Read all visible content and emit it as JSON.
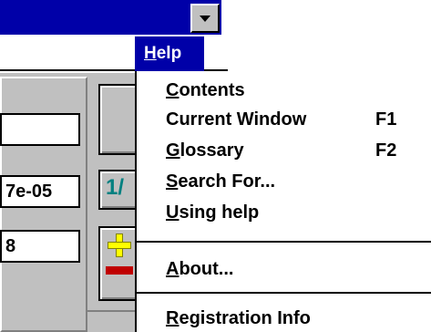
{
  "window": {
    "title": "",
    "dropdown_button_icon": "down-arrow-icon"
  },
  "menubar": {
    "help": {
      "first": "H",
      "rest": "elp"
    }
  },
  "panel": {
    "field2_value": "7e-05",
    "field3_value": "8",
    "fraction_button_text": "1/",
    "plus_icon": "plus-icon",
    "minus_icon": "minus-icon"
  },
  "help_menu": {
    "items": [
      {
        "first": "C",
        "rest": "ontents",
        "accel": ""
      },
      {
        "pre": "Current Window",
        "accel": "F1"
      },
      {
        "first": "G",
        "rest": "lossary",
        "accel": "F2"
      },
      {
        "first": "S",
        "rest": "earch For...",
        "accel": ""
      },
      {
        "first": "U",
        "rest": "sing help",
        "accel": ""
      },
      {
        "first": "A",
        "rest": "bout...",
        "accel": ""
      },
      {
        "first": "R",
        "rest": "egistration Info",
        "accel": ""
      }
    ]
  },
  "colors": {
    "title_bar": "#0000a8",
    "highlight": "#0000a8",
    "face": "#c0c0c0",
    "fraction_text": "#008080",
    "plus": "#ffff00",
    "minus": "#c00000"
  }
}
